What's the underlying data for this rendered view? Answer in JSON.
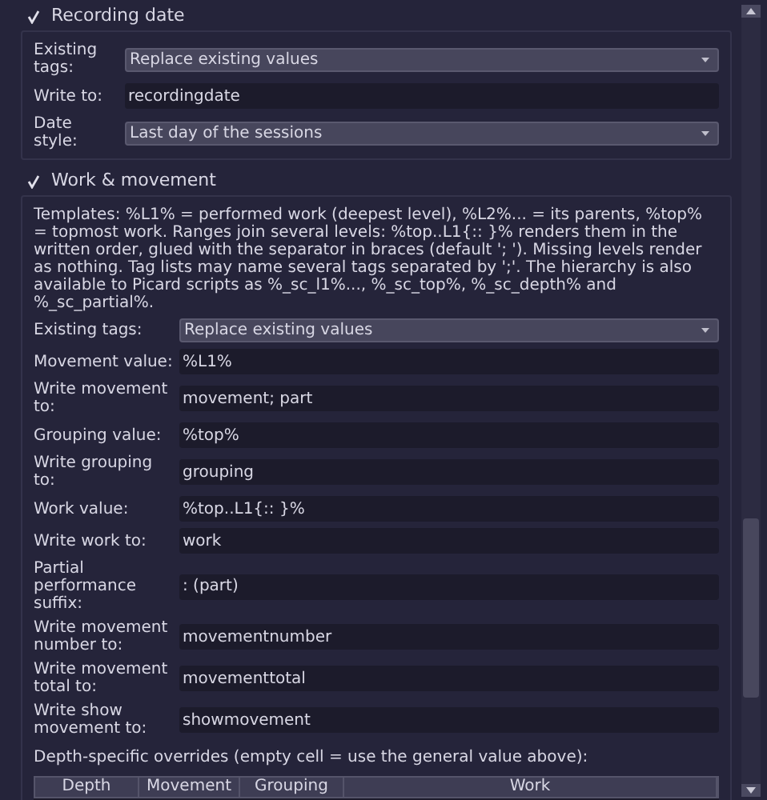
{
  "groups": [
    {
      "title": "Recording date",
      "checked": true,
      "rows": [
        {
          "kind": "combo",
          "label": "Existing tags:",
          "value": "Replace existing values"
        },
        {
          "kind": "text",
          "label": "Write to:",
          "value": "recordingdate"
        },
        {
          "kind": "combo",
          "label": "Date style:",
          "value": "Last day of the sessions"
        }
      ]
    },
    {
      "title": "Work & movement",
      "checked": true,
      "description": "Templates: %L1% = performed work (deepest level), %L2%... = its parents, %top% = topmost work. Ranges join several levels: %top..L1{:: }% renders them in the written order, glued with the separator in braces (default '; '). Missing levels render as nothing. Tag lists may name several tags separated by ';'. The hierarchy is also available to Picard scripts as %_sc_l1%..., %_sc_top%, %_sc_depth% and %_sc_partial%.",
      "rows": [
        {
          "kind": "combo",
          "label": "Existing tags:",
          "value": "Replace existing values"
        },
        {
          "kind": "text",
          "label": "Movement value:",
          "value": "%L1%"
        },
        {
          "kind": "text",
          "label": "Write movement to:",
          "value": "movement; part"
        },
        {
          "kind": "text",
          "label": "Grouping value:",
          "value": "%top%"
        },
        {
          "kind": "text",
          "label": "Write grouping to:",
          "value": "grouping"
        },
        {
          "kind": "text",
          "label": "Work value:",
          "value": "%top..L1{:: }%"
        },
        {
          "kind": "text",
          "label": "Write work to:",
          "value": "work"
        },
        {
          "kind": "text",
          "label": "Partial performance suffix:",
          "value": ": (part)"
        },
        {
          "kind": "text",
          "label": "Write movement number to:",
          "value": "movementnumber"
        },
        {
          "kind": "text",
          "label": "Write movement total to:",
          "value": "movementtotal"
        },
        {
          "kind": "text",
          "label": "Write show movement to:",
          "value": "showmovement"
        }
      ],
      "table_caption": "Depth-specific overrides (empty cell = use the general value above):",
      "table": {
        "columns": [
          "Depth",
          "Movement",
          "Grouping",
          "Work"
        ]
      }
    }
  ]
}
